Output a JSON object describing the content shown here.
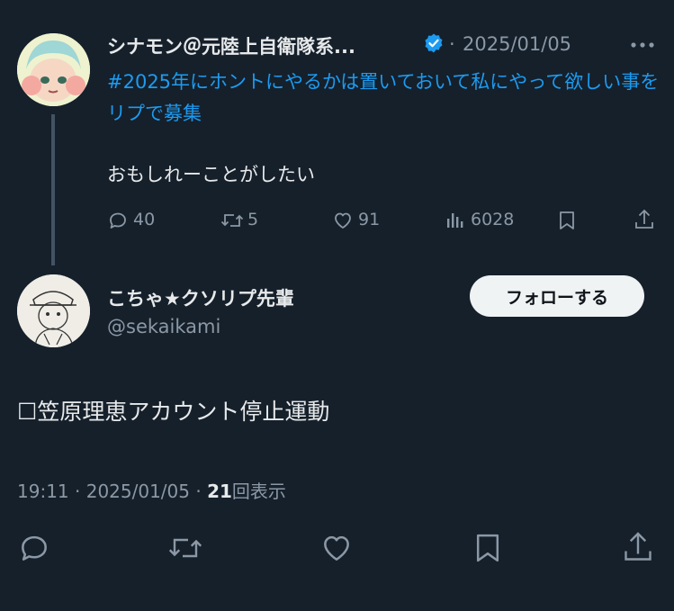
{
  "parent_tweet": {
    "author_name": "シナモン＠元陸上自衛隊系...",
    "separator": "·",
    "date": "2025/01/05",
    "more_icon": "more-icon",
    "verified_icon": "verified-badge-icon",
    "text_link": "#2025年にホントにやるかは置いておいて私にやって欲しい事をリプで募集",
    "text_body": "おもしれーことがしたい",
    "stats": {
      "replies": "40",
      "retweets": "5",
      "likes": "91",
      "views": "6028"
    }
  },
  "reply_tweet": {
    "author_name": "こちゃ★クソリプ先輩",
    "handle": "@sekaikami",
    "follow_label": "フォローする",
    "text": "☐笠原理恵アカウント停止運動",
    "time": "19:11",
    "date": "2025/01/05",
    "sep": "·",
    "views_count": "21",
    "views_label": "回表示"
  },
  "colors": {
    "background": "#15202b",
    "link": "#1d9bf0",
    "muted": "#8b98a5",
    "text": "#e7e9ea"
  }
}
